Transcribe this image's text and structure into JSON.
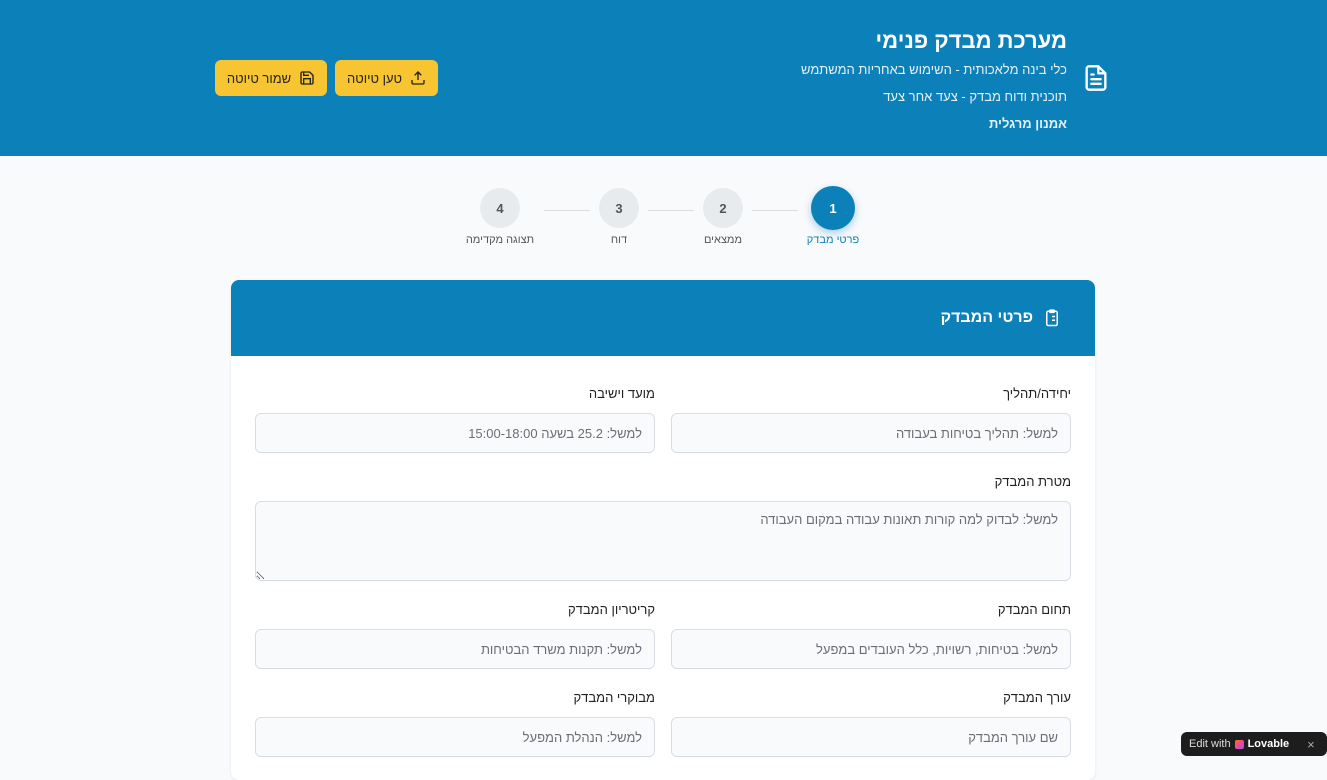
{
  "header": {
    "title": "מערכת מבדק פנימי",
    "subtitle1": "כלי בינה מלאכותית - השימוש באחריות המשתמש",
    "subtitle2": "תוכנית ודוח מבדק - צעד אחר צעד",
    "author": "אמנון מרגלית",
    "load_label": "טען טיוטה",
    "save_label": "שמור טיוטה"
  },
  "steps": [
    {
      "num": "1",
      "label": "פרטי מבדק"
    },
    {
      "num": "2",
      "label": "ממצאים"
    },
    {
      "num": "3",
      "label": "דוח"
    },
    {
      "num": "4",
      "label": "תצוגה מקדימה"
    }
  ],
  "card": {
    "title": "פרטי המבדק",
    "fields": {
      "unit": {
        "label": "יחידה/תהליך",
        "placeholder": "למשל: תהליך בטיחות בעבודה"
      },
      "date": {
        "label": "מועד וישיבה",
        "placeholder": "למשל: 25.2 בשעה 15:00-18:00"
      },
      "goal": {
        "label": "מטרת המבדק",
        "placeholder": "למשל: לבדוק למה קורות תאונות עבודה במקום העבודה"
      },
      "scope": {
        "label": "תחום המבדק",
        "placeholder": "למשל: בטיחות, רשויות, כלל העובדים במפעל"
      },
      "criteria": {
        "label": "קריטריון המבדק",
        "placeholder": "למשל: תקנות משרד הבטיחות"
      },
      "auditor": {
        "label": "עורך המבדק",
        "placeholder": "שם עורך המבדק"
      },
      "auditees": {
        "label": "מבוקרי המבדק",
        "placeholder": "למשל: הנהלת המפעל"
      }
    }
  },
  "badge": {
    "edit": "Edit with",
    "brand": "Lovable",
    "close": "×"
  },
  "colors": {
    "primary": "#0c80b8",
    "accent": "#f6c531"
  }
}
